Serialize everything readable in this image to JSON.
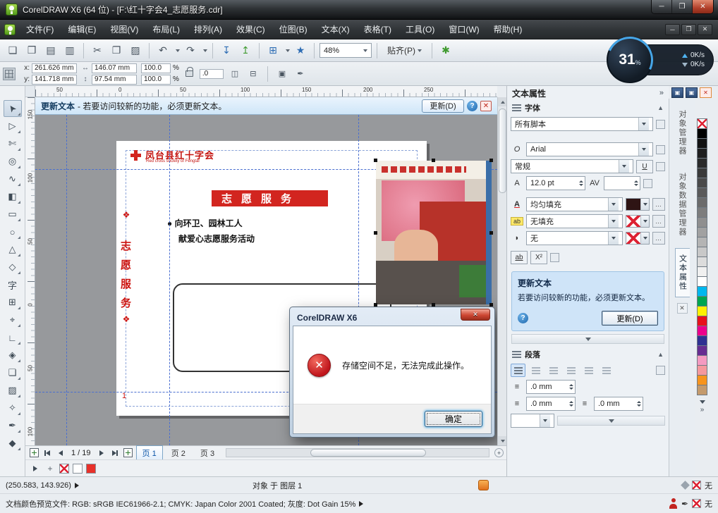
{
  "glyphs": {
    "close": "✕",
    "minimize": "─",
    "restore": "❐",
    "chevrons": "»",
    "pen": "✒",
    "box": "▣"
  },
  "titlebar": {
    "title": "CorelDRAW X6 (64 位) - [F:\\红十字会4_志愿服务.cdr]"
  },
  "menubar": {
    "items": [
      "文件(F)",
      "编辑(E)",
      "视图(V)",
      "布局(L)",
      "排列(A)",
      "效果(C)",
      "位图(B)",
      "文本(X)",
      "表格(T)",
      "工具(O)",
      "窗口(W)",
      "帮助(H)"
    ]
  },
  "toolbar": {
    "icons": [
      {
        "name": "new",
        "glyph": "❏"
      },
      {
        "name": "open",
        "glyph": "❒"
      },
      {
        "name": "save",
        "glyph": "▤"
      },
      {
        "name": "print",
        "glyph": "▥"
      },
      {
        "name": "cut",
        "glyph": "✂"
      },
      {
        "name": "copy",
        "glyph": "❐"
      },
      {
        "name": "paste",
        "glyph": "▨"
      },
      {
        "name": "undo",
        "glyph": "↶"
      },
      {
        "name": "redo",
        "glyph": "↷"
      },
      {
        "name": "import",
        "glyph": "↧"
      },
      {
        "name": "export",
        "glyph": "↥"
      },
      {
        "name": "app-launcher",
        "glyph": "⊞"
      },
      {
        "name": "welcome-screen",
        "glyph": "★"
      }
    ],
    "zoom": "48%",
    "snap": "贴齐(P)",
    "options_glyph": "✱"
  },
  "propbar": {
    "x_label": "x:",
    "y_label": "y:",
    "x_value": "261.626 mm",
    "y_value": "141.718 mm",
    "w_value": "146.07 mm",
    "h_value": "97.54 mm",
    "scale_x": "100.0",
    "scale_y": "100.0",
    "percent": "%",
    "angle": ".0",
    "mirror_h": "◫",
    "mirror_v": "⊟"
  },
  "gauge": {
    "value": "31",
    "unit": "%",
    "up": "0K/s",
    "down": "0K/s"
  },
  "hruler": {
    "numbers": [
      "50",
      "0",
      "50",
      "100",
      "150",
      "200",
      "250"
    ]
  },
  "vruler": {
    "numbers": [
      "150",
      "100",
      "50",
      "0",
      "50",
      "100"
    ]
  },
  "toolbox": {
    "tools": [
      {
        "name": "pick-tool",
        "glyph": "➤"
      },
      {
        "name": "shape-tool",
        "glyph": "▷"
      },
      {
        "name": "crop-tool",
        "glyph": "✄"
      },
      {
        "name": "zoom-tool",
        "glyph": "◎"
      },
      {
        "name": "freehand-tool",
        "glyph": "∿"
      },
      {
        "name": "smart-fill-tool",
        "glyph": "◧"
      },
      {
        "name": "rectangle-tool",
        "glyph": "▭"
      },
      {
        "name": "ellipse-tool",
        "glyph": "○"
      },
      {
        "name": "polygon-tool",
        "glyph": "△"
      },
      {
        "name": "basic-shapes-tool",
        "glyph": "◇"
      },
      {
        "name": "text-tool",
        "glyph": "字"
      },
      {
        "name": "table-tool",
        "glyph": "⊞"
      },
      {
        "name": "dimension-tool",
        "glyph": "⌖"
      },
      {
        "name": "connector-tool",
        "glyph": "∟"
      },
      {
        "name": "blend-tool",
        "glyph": "◈"
      },
      {
        "name": "shadow-tool",
        "glyph": "❏"
      },
      {
        "name": "transparency-tool",
        "glyph": "▨"
      },
      {
        "name": "eyedropper-tool",
        "glyph": "✧"
      },
      {
        "name": "outline-pen-tool",
        "glyph": "✒"
      },
      {
        "name": "fill-tool",
        "glyph": "◆"
      }
    ]
  },
  "infobar": {
    "title": "更新文本",
    "message": "- 若要访问较新的功能，必须更新文本。",
    "update": "更新(D)",
    "help": "?"
  },
  "page": {
    "org": "凤台县红十字会",
    "org_en": "Red cross society of Fengtai",
    "banner": "志愿服务",
    "vchars": [
      "志",
      "愿",
      "服",
      "务"
    ],
    "diamonds": "❖",
    "bullet": "●",
    "line1": "向环卫、园林工人",
    "line2": "献爱心志愿服务活动",
    "pagenum": "1"
  },
  "dialog": {
    "title": "CorelDRAW X6",
    "message": "存储空间不足，无法完成此操作。",
    "ok": "确定"
  },
  "docker": {
    "title": "文本属性",
    "char_section": "字体",
    "script": "所有脚本",
    "font": "Arial",
    "style": "常规",
    "size": "12.0 pt",
    "kern_value": "",
    "fill_type": "均匀填充",
    "outline_type": "无填充",
    "bg_type": "无",
    "icons": {
      "font_o": "O",
      "size": "A",
      "kern": "AV",
      "fill": "A",
      "outline": "ab",
      "bg": "◗",
      "chars": "ab",
      "sup": "X²",
      "underline": "U"
    },
    "update_title": "更新文本",
    "update_message": "若要访问较新的功能，必须更新文本。",
    "update_button": "更新(D)",
    "help": "?",
    "para_section": "段落",
    "indent1": ".0 mm",
    "indent2": ".0 mm",
    "indent3": ".0 mm"
  },
  "side_tabs": {
    "tabs": [
      "对象管理器",
      "对象数据管理器",
      "文本属性"
    ]
  },
  "palette": {
    "colors": [
      "#000000",
      "#121212",
      "#1f1f1f",
      "#2b2b2b",
      "#3a3a3a",
      "#4a4a4a",
      "#5a5a5a",
      "#6b6b6b",
      "#7d7d7d",
      "#8f8f8f",
      "#a1a1a1",
      "#b4b4b4",
      "#c8c8c8",
      "#dcdcdc",
      "#f0f0f0",
      "#ffffff",
      "#00b7ee",
      "#00a650",
      "#fff100",
      "#e8111c",
      "#ec008c",
      "#2e3192",
      "#662d91",
      "#f49ac1",
      "#f5989d",
      "#f7941d",
      "#c49a6c"
    ]
  },
  "doc_palette": {
    "colors": [
      "#ffffff",
      "#e8312a"
    ]
  },
  "pagenav": {
    "info": "1 / 19",
    "tabs": [
      "页 1",
      "页 2",
      "页 3"
    ]
  },
  "status": {
    "coords": "(250.583, 143.926)",
    "object_info": "对象 于 图层 1",
    "profile": "文档颜色预览文件: RGB: sRGB IEC61966-2.1; CMYK: Japan Color 2001 Coated; 灰度: Dot Gain 15%",
    "fill_none": "无",
    "outline_none": "无"
  }
}
